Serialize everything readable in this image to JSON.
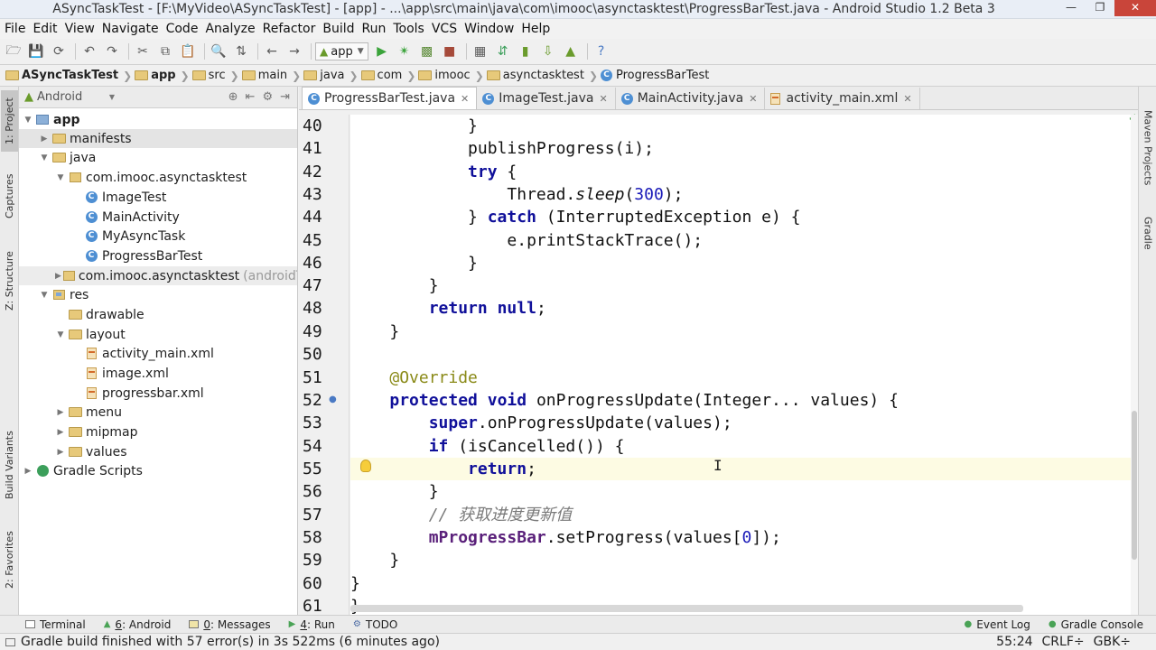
{
  "window": {
    "title": "ASyncTaskTest - [F:\\MyVideo\\ASyncTaskTest] - [app] - ...\\app\\src\\main\\java\\com\\imooc\\asynctasktest\\ProgressBarTest.java - Android Studio 1.2 Beta 3"
  },
  "menu": [
    "File",
    "Edit",
    "View",
    "Navigate",
    "Code",
    "Analyze",
    "Refactor",
    "Build",
    "Run",
    "Tools",
    "VCS",
    "Window",
    "Help"
  ],
  "toolbar": {
    "run_config": "app"
  },
  "breadcrumb": [
    "ASyncTaskTest",
    "app",
    "src",
    "main",
    "java",
    "com",
    "imooc",
    "asynctasktest",
    "ProgressBarTest"
  ],
  "left_tabs": [
    "1: Project",
    "Captures",
    "Z: Structure",
    "Build Variants",
    "2: Favorites"
  ],
  "right_tabs": [
    "Maven Projects",
    "Gradle"
  ],
  "project": {
    "view_mode": "Android",
    "tree": [
      {
        "label": "app",
        "suffix": ""
      },
      {
        "label": "manifests",
        "suffix": ""
      },
      {
        "label": "java",
        "suffix": ""
      },
      {
        "label": "com.imooc.asynctasktest",
        "suffix": ""
      },
      {
        "label": "ImageTest",
        "suffix": ""
      },
      {
        "label": "MainActivity",
        "suffix": ""
      },
      {
        "label": "MyAsyncTask",
        "suffix": ""
      },
      {
        "label": "ProgressBarTest",
        "suffix": ""
      },
      {
        "label": "com.imooc.asynctasktest",
        "suffix": "(androidTes"
      },
      {
        "label": "res",
        "suffix": ""
      },
      {
        "label": "drawable",
        "suffix": ""
      },
      {
        "label": "layout",
        "suffix": ""
      },
      {
        "label": "activity_main.xml",
        "suffix": ""
      },
      {
        "label": "image.xml",
        "suffix": ""
      },
      {
        "label": "progressbar.xml",
        "suffix": ""
      },
      {
        "label": "menu",
        "suffix": ""
      },
      {
        "label": "mipmap",
        "suffix": ""
      },
      {
        "label": "values",
        "suffix": ""
      },
      {
        "label": "Gradle Scripts",
        "suffix": ""
      }
    ]
  },
  "editor": {
    "tabs": [
      "ProgressBarTest.java",
      "ImageTest.java",
      "MainActivity.java",
      "activity_main.xml"
    ],
    "active_tab": "ProgressBarTest.java",
    "current_line": "55",
    "lines": [
      {
        "n": "40",
        "text": "            }"
      },
      {
        "n": "41",
        "text": "            publishProgress(i);"
      },
      {
        "n": "42",
        "text": "            try {"
      },
      {
        "n": "43",
        "text": "                Thread.sleep(300);"
      },
      {
        "n": "44",
        "text": "            } catch (InterruptedException e) {"
      },
      {
        "n": "45",
        "text": "                e.printStackTrace();"
      },
      {
        "n": "46",
        "text": "            }"
      },
      {
        "n": "47",
        "text": "        }"
      },
      {
        "n": "48",
        "text": "        return null;"
      },
      {
        "n": "49",
        "text": "    }"
      },
      {
        "n": "50",
        "text": ""
      },
      {
        "n": "51",
        "text": "    @Override"
      },
      {
        "n": "52",
        "text": "    protected void onProgressUpdate(Integer... values) {"
      },
      {
        "n": "53",
        "text": "        super.onProgressUpdate(values);"
      },
      {
        "n": "54",
        "text": "        if (isCancelled()) {"
      },
      {
        "n": "55",
        "text": "            return;"
      },
      {
        "n": "56",
        "text": "        }"
      },
      {
        "n": "57",
        "text": "        // 获取进度更新值"
      },
      {
        "n": "58",
        "text": "        mProgressBar.setProgress(values[0]);"
      },
      {
        "n": "59",
        "text": "    }"
      },
      {
        "n": "60",
        "text": "}"
      },
      {
        "n": "61",
        "text": "}"
      }
    ]
  },
  "tool_windows": {
    "left": [
      {
        "num": "",
        "label": "Terminal"
      },
      {
        "num": "6",
        "label": ": Android"
      },
      {
        "num": "0",
        "label": ": Messages"
      },
      {
        "num": "4",
        "label": ": Run"
      },
      {
        "num": "",
        "label": "TODO"
      }
    ],
    "right": [
      {
        "num": "",
        "label": "Event Log"
      },
      {
        "num": "",
        "label": "Gradle Console"
      }
    ]
  },
  "status": {
    "message": "Gradle build finished with 57 error(s) in 3s 522ms (6 minutes ago)",
    "position": "55:24",
    "line_sep": "CRLF÷",
    "encoding": "GBK÷"
  }
}
